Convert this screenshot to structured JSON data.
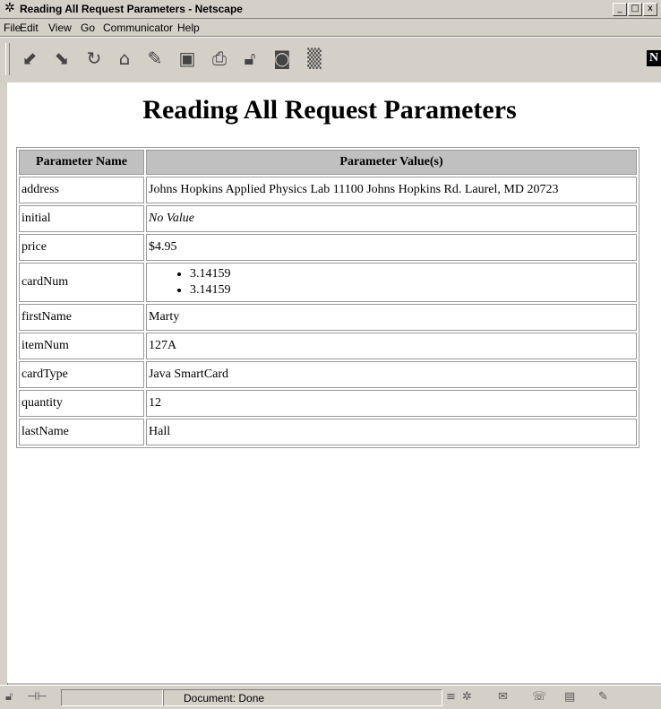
{
  "window": {
    "title": "Reading All Request Parameters - Netscape",
    "controls": {
      "minimize": "_",
      "maximize": "□",
      "close": "x"
    }
  },
  "menu": {
    "items": [
      "File",
      "Edit",
      "View",
      "Go",
      "Communicator",
      "Help"
    ]
  },
  "toolbar": {
    "icons": [
      "back-icon",
      "forward-icon",
      "reload-icon",
      "home-icon",
      "search-icon",
      "my-netscape-icon",
      "print-icon",
      "security-icon",
      "shop-icon",
      "stop-icon"
    ],
    "logo": "N"
  },
  "page": {
    "heading": "Reading All Request Parameters",
    "table": {
      "headers": [
        "Parameter Name",
        "Parameter Value(s)"
      ],
      "rows": [
        {
          "name": "address",
          "value": "Johns Hopkins Applied Physics Lab 11100 Johns Hopkins Rd. Laurel, MD 20723"
        },
        {
          "name": "initial",
          "value": "No Value"
        },
        {
          "name": "price",
          "value": "$4.95"
        },
        {
          "name": "cardNum",
          "values": [
            "3.14159",
            "3.14159"
          ]
        },
        {
          "name": "firstName",
          "value": "Marty"
        },
        {
          "name": "itemNum",
          "value": "127A"
        },
        {
          "name": "cardType",
          "value": "Java SmartCard"
        },
        {
          "name": "quantity",
          "value": "12"
        },
        {
          "name": "lastName",
          "value": "Hall"
        }
      ]
    }
  },
  "status": {
    "text": "Document: Done"
  }
}
